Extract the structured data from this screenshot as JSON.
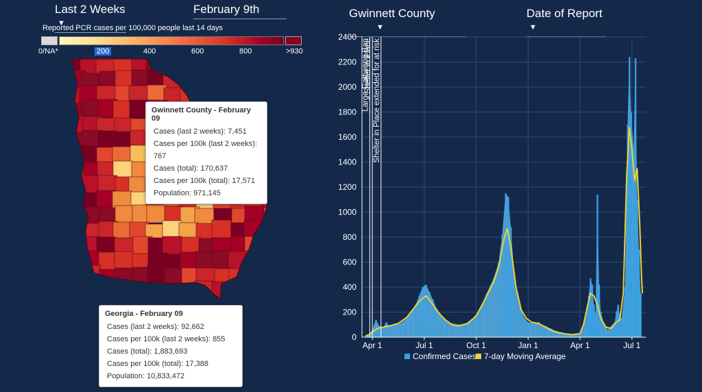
{
  "controls": {
    "period": "Last 2 Weeks",
    "date": "February 9th",
    "county": "Gwinnett County",
    "date_type": "Date of Report"
  },
  "legend": {
    "title": "Reported PCR cases per 100,000 people last 14 days",
    "na_label": "0/NA*",
    "ticks": [
      "200",
      "400",
      "600",
      "800"
    ],
    "max_label": ">930"
  },
  "colors": {
    "background": "#14294a",
    "bars": "#39a0e0",
    "area": "#5db2e6",
    "moving_avg": "#f0d132"
  },
  "county_tooltip": {
    "title": "Gwinnett County - February 09",
    "rows": [
      "Cases (last 2 weeks): 7,451",
      "Cases per 100k (last 2 weeks): 767",
      "Cases (total): 170,637",
      "Cases per 100k (total): 17,571",
      "Population: 971,145"
    ]
  },
  "state_tooltip": {
    "title": "Georgia - February 09",
    "rows": [
      "Cases (last 2 weeks): 92,662",
      "Cases per 100k (last 2 weeks): 855",
      "Cases (total): 1,883,693",
      "Cases per 100k (total): 17,388",
      "Population: 10,833,472"
    ]
  },
  "chart_data": {
    "type": "bar",
    "ylim": [
      0,
      2400
    ],
    "yticks": [
      0,
      200,
      400,
      600,
      800,
      1000,
      1200,
      1400,
      1600,
      1800,
      2000,
      2200,
      2400
    ],
    "xticks": [
      "Apr 1",
      "Jul 1",
      "Oct 1",
      "Jan 1",
      "Apr 1",
      "Jul 1",
      "Oct 1",
      "Jan 1"
    ],
    "xtick_month_index": [
      0,
      3,
      6,
      9,
      12,
      15,
      18,
      21
    ],
    "grid": true,
    "legend_position": "bottom",
    "series": [
      {
        "name": "Confirmed Cases",
        "kind": "bar",
        "points": [
          [
            -0.4,
            5
          ],
          [
            -0.2,
            20
          ],
          [
            0,
            60
          ],
          [
            0.2,
            140
          ],
          [
            0.4,
            90
          ],
          [
            0.6,
            70
          ],
          [
            0.8,
            120
          ],
          [
            1,
            85
          ],
          [
            1.3,
            100
          ],
          [
            1.6,
            110
          ],
          [
            1.9,
            140
          ],
          [
            2.2,
            190
          ],
          [
            2.5,
            260
          ],
          [
            2.7,
            330
          ],
          [
            2.9,
            400
          ],
          [
            3.1,
            420
          ],
          [
            3.3,
            360
          ],
          [
            3.5,
            300
          ],
          [
            3.7,
            230
          ],
          [
            4,
            170
          ],
          [
            4.3,
            130
          ],
          [
            4.6,
            110
          ],
          [
            5,
            100
          ],
          [
            5.4,
            110
          ],
          [
            5.8,
            150
          ],
          [
            6.2,
            220
          ],
          [
            6.6,
            350
          ],
          [
            7,
            470
          ],
          [
            7.3,
            600
          ],
          [
            7.5,
            820
          ],
          [
            7.7,
            1150
          ],
          [
            7.85,
            1120
          ],
          [
            8,
            880
          ],
          [
            8.2,
            500
          ],
          [
            8.4,
            320
          ],
          [
            8.6,
            210
          ],
          [
            8.8,
            150
          ],
          [
            9,
            120
          ],
          [
            9.3,
            110
          ],
          [
            9.6,
            120
          ],
          [
            9.8,
            95
          ],
          [
            10,
            90
          ],
          [
            10.3,
            70
          ],
          [
            10.6,
            50
          ],
          [
            10.9,
            40
          ],
          [
            11.2,
            30
          ],
          [
            11.5,
            20
          ],
          [
            11.8,
            25
          ],
          [
            12,
            35
          ],
          [
            12.2,
            80
          ],
          [
            12.4,
            200
          ],
          [
            12.5,
            330
          ],
          [
            12.6,
            470
          ],
          [
            12.7,
            420
          ],
          [
            12.8,
            260
          ],
          [
            12.9,
            180
          ],
          [
            13,
            1140
          ],
          [
            13.1,
            420
          ],
          [
            13.2,
            200
          ],
          [
            13.4,
            100
          ],
          [
            13.6,
            60
          ],
          [
            13.8,
            90
          ],
          [
            14,
            120
          ],
          [
            14.1,
            200
          ],
          [
            14.2,
            260
          ],
          [
            14.3,
            180
          ],
          [
            14.4,
            150
          ],
          [
            14.6,
            400
          ],
          [
            14.75,
            1700
          ],
          [
            14.85,
            2240
          ],
          [
            14.95,
            1800
          ],
          [
            15.1,
            1500
          ],
          [
            15.2,
            2230
          ],
          [
            15.3,
            1100
          ],
          [
            15.4,
            700
          ],
          [
            15.5,
            350
          ]
        ]
      },
      {
        "name": "7-day Moving Average",
        "kind": "line",
        "points": [
          [
            -0.4,
            10
          ],
          [
            -0.2,
            20
          ],
          [
            0,
            40
          ],
          [
            0.3,
            70
          ],
          [
            0.6,
            80
          ],
          [
            1,
            90
          ],
          [
            1.5,
            110
          ],
          [
            2,
            160
          ],
          [
            2.5,
            250
          ],
          [
            2.8,
            300
          ],
          [
            3.1,
            330
          ],
          [
            3.4,
            280
          ],
          [
            3.8,
            200
          ],
          [
            4.2,
            140
          ],
          [
            4.6,
            100
          ],
          [
            5,
            90
          ],
          [
            5.5,
            110
          ],
          [
            6,
            170
          ],
          [
            6.5,
            300
          ],
          [
            7,
            440
          ],
          [
            7.3,
            560
          ],
          [
            7.6,
            780
          ],
          [
            7.8,
            870
          ],
          [
            8,
            720
          ],
          [
            8.3,
            400
          ],
          [
            8.6,
            220
          ],
          [
            8.9,
            150
          ],
          [
            9.2,
            120
          ],
          [
            9.6,
            110
          ],
          [
            10,
            80
          ],
          [
            10.4,
            50
          ],
          [
            10.8,
            35
          ],
          [
            11.2,
            25
          ],
          [
            11.6,
            20
          ],
          [
            12,
            30
          ],
          [
            12.2,
            100
          ],
          [
            12.4,
            230
          ],
          [
            12.6,
            350
          ],
          [
            12.8,
            330
          ],
          [
            13,
            260
          ],
          [
            13.2,
            150
          ],
          [
            13.5,
            80
          ],
          [
            13.8,
            70
          ],
          [
            14.1,
            120
          ],
          [
            14.3,
            140
          ],
          [
            14.5,
            350
          ],
          [
            14.7,
            1300
          ],
          [
            14.85,
            1680
          ],
          [
            15,
            1500
          ],
          [
            15.15,
            1250
          ],
          [
            15.3,
            1350
          ],
          [
            15.45,
            900
          ],
          [
            15.55,
            500
          ],
          [
            15.6,
            350
          ]
        ]
      }
    ],
    "annotations": [
      {
        "x": -0.15,
        "label": "Large Gathering Ban"
      },
      {
        "x": 0.0,
        "label": "Shelter in Place"
      },
      {
        "x": 0.5,
        "label": "Shelter in Place extended for at risk"
      }
    ]
  }
}
